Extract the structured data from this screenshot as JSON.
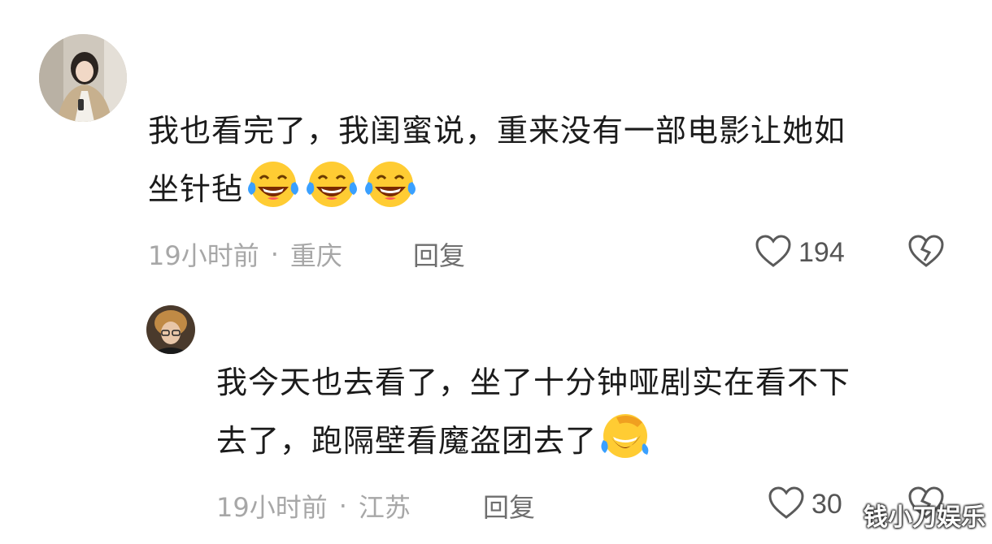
{
  "comments": [
    {
      "username": "",
      "text_line1": "我也看完了，我闺蜜说，重来没有一部电影让她如",
      "text_line2": "坐针毡",
      "emojis": [
        "laugh-cry-emoji",
        "laugh-cry-emoji",
        "laugh-cry-emoji"
      ],
      "time": "19小时前",
      "separator": "·",
      "location": "重庆",
      "reply_label": "回复",
      "like_count": "194",
      "like_icon": "heart-outline-icon",
      "dislike_icon": "broken-heart-icon"
    },
    {
      "username": "",
      "text_line1": "我今天也去看了，坐了十分钟哑剧实在看不下",
      "text_line2": "去了，跑隔壁看魔盗团去了",
      "emojis": [
        "rolling-laugh-emoji"
      ],
      "time": "19小时前",
      "separator": "·",
      "location": "江苏",
      "reply_label": "回复",
      "like_count": "30",
      "like_icon": "heart-outline-icon",
      "dislike_icon": "broken-heart-icon"
    }
  ],
  "watermark": "钱小刀娱乐"
}
